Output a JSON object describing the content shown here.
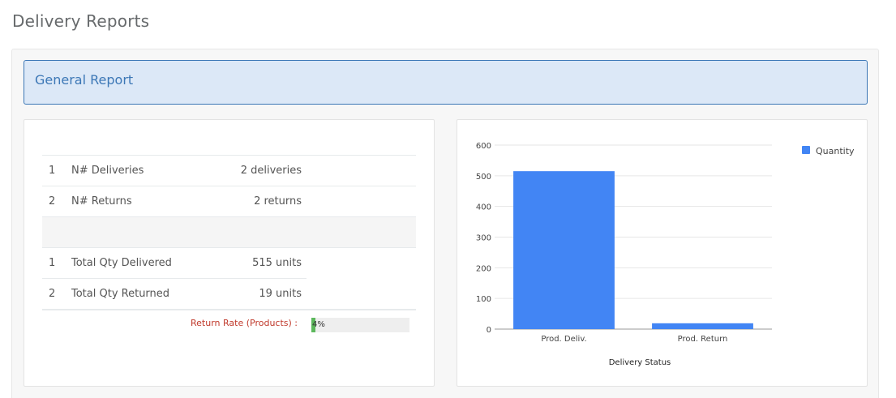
{
  "page": {
    "title": "Delivery Reports"
  },
  "section": {
    "title": "General Report"
  },
  "stats": {
    "rows": [
      {
        "num": "1",
        "label": "N# Deliveries",
        "value": "2 deliveries"
      },
      {
        "num": "2",
        "label": "N# Returns",
        "value": "2 returns"
      },
      {
        "num": "1",
        "label": "Total Qty Delivered",
        "value": "515 units"
      },
      {
        "num": "2",
        "label": "Total Qty Returned",
        "value": "19 units"
      }
    ],
    "return_rate": {
      "label": "Return Rate (Products) :",
      "text": "4%",
      "percent": 4
    }
  },
  "colors": {
    "accent": "#4285f4",
    "header_bg": "#dce8f7",
    "header_border": "#3c77b6",
    "bar_fill": "#5cb85c",
    "rate_label": "#c0392b"
  },
  "chart_data": {
    "type": "bar",
    "categories": [
      "Prod. Deliv.",
      "Prod. Return"
    ],
    "series": [
      {
        "name": "Quantity",
        "values": [
          515,
          19
        ]
      }
    ],
    "xlabel": "Delivery Status",
    "ylabel": "",
    "ylim": [
      0,
      600
    ],
    "yticks": [
      0,
      100,
      200,
      300,
      400,
      500,
      600
    ],
    "grid": true,
    "legend": "top-right",
    "color": "#4285f4"
  }
}
